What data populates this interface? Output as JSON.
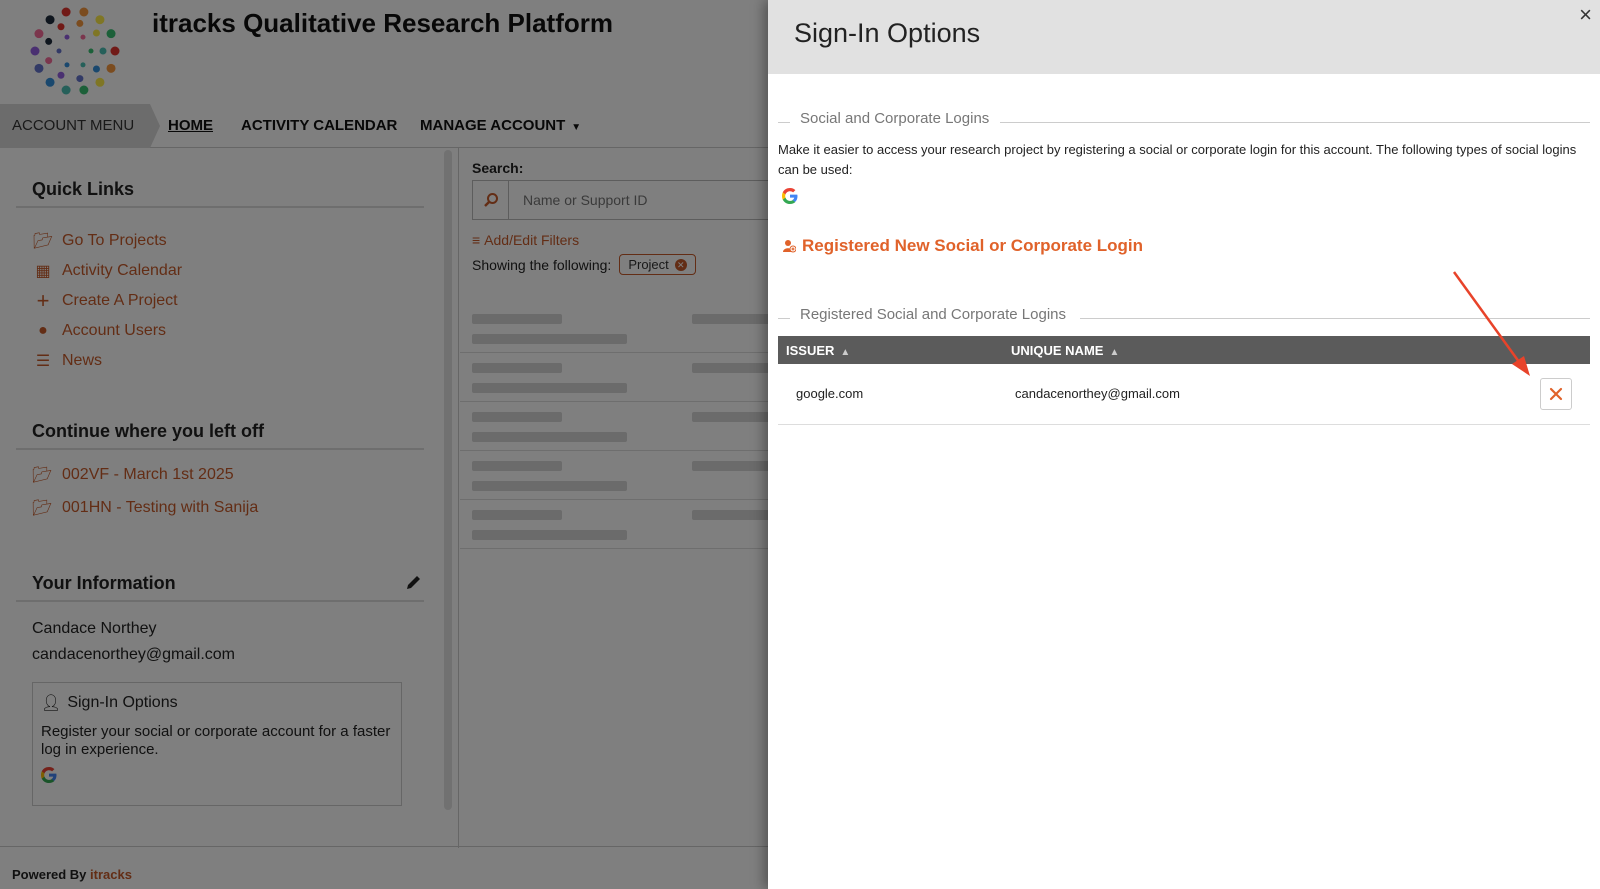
{
  "app": {
    "title": "itracks Qualitative Research Platform"
  },
  "nav": {
    "account_menu": "ACCOUNT MENU",
    "home": "HOME",
    "activity_calendar": "ACTIVITY CALENDAR",
    "manage_account": "MANAGE ACCOUNT"
  },
  "quick_links": {
    "heading": "Quick Links",
    "items": [
      {
        "label": "Go To Projects",
        "icon": "folder-open-icon"
      },
      {
        "label": "Activity Calendar",
        "icon": "calendar-icon"
      },
      {
        "label": "Create A Project",
        "icon": "plus-icon"
      },
      {
        "label": "Account Users",
        "icon": "users-icon"
      },
      {
        "label": "News",
        "icon": "list-icon"
      }
    ]
  },
  "continue": {
    "heading": "Continue where you left off",
    "items": [
      {
        "label": "002VF - March 1st 2025"
      },
      {
        "label": "001HN - Testing with Sanija"
      }
    ]
  },
  "your_info": {
    "heading": "Your Information",
    "name": "Candace Northey",
    "email": "candacenorthey@gmail.com",
    "signin_card": {
      "title": "Sign-In Options",
      "description": "Register your social or corporate account for a faster log in experience."
    }
  },
  "search": {
    "label": "Search:",
    "placeholder": "Name or Support ID",
    "filters_link": "Add/Edit Filters",
    "showing_label": "Showing the following:",
    "chip": "Project"
  },
  "footer": {
    "powered_by": "Powered By",
    "brand": "itracks"
  },
  "drawer": {
    "title": "Sign-In Options",
    "close": "×",
    "social_section": {
      "heading": "Social and Corporate Logins",
      "intro": "Make it easier to access your research project by registering a social or corporate login for this account. The following types of social logins can be used:",
      "register_link": "Registered New Social or Corporate Login"
    },
    "registered_section": {
      "heading": "Registered Social and Corporate Logins",
      "columns": {
        "issuer": "ISSUER",
        "unique_name": "UNIQUE NAME"
      },
      "rows": [
        {
          "issuer": "google.com",
          "unique_name": "candacenorthey@gmail.com"
        }
      ]
    }
  },
  "colors": {
    "accent": "#e0622a",
    "table_header": "#5b5b5b",
    "annotation_arrow": "#e8432a"
  }
}
